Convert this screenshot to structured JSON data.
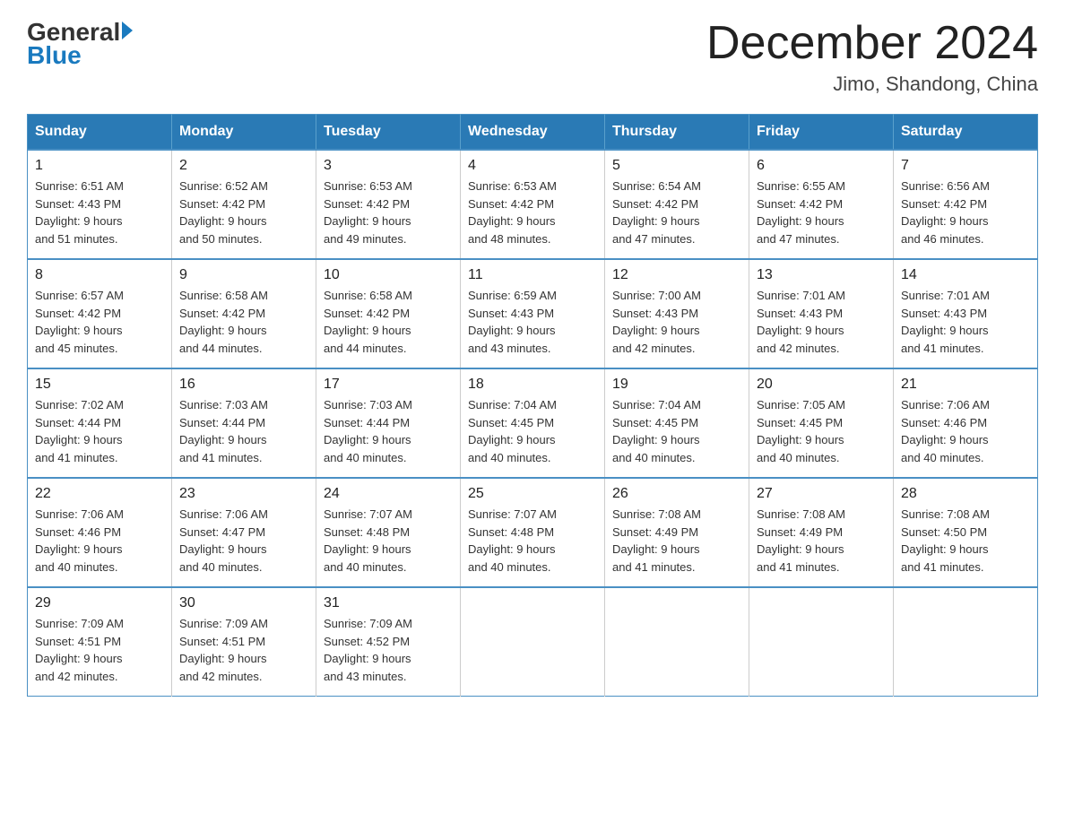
{
  "header": {
    "logo": {
      "general": "General",
      "arrow": "▶",
      "blue": "Blue"
    },
    "title": "December 2024",
    "location": "Jimo, Shandong, China"
  },
  "calendar": {
    "days_of_week": [
      "Sunday",
      "Monday",
      "Tuesday",
      "Wednesday",
      "Thursday",
      "Friday",
      "Saturday"
    ],
    "weeks": [
      [
        {
          "day": "1",
          "sunrise": "6:51 AM",
          "sunset": "4:43 PM",
          "daylight": "9 hours and 51 minutes."
        },
        {
          "day": "2",
          "sunrise": "6:52 AM",
          "sunset": "4:42 PM",
          "daylight": "9 hours and 50 minutes."
        },
        {
          "day": "3",
          "sunrise": "6:53 AM",
          "sunset": "4:42 PM",
          "daylight": "9 hours and 49 minutes."
        },
        {
          "day": "4",
          "sunrise": "6:53 AM",
          "sunset": "4:42 PM",
          "daylight": "9 hours and 48 minutes."
        },
        {
          "day": "5",
          "sunrise": "6:54 AM",
          "sunset": "4:42 PM",
          "daylight": "9 hours and 47 minutes."
        },
        {
          "day": "6",
          "sunrise": "6:55 AM",
          "sunset": "4:42 PM",
          "daylight": "9 hours and 47 minutes."
        },
        {
          "day": "7",
          "sunrise": "6:56 AM",
          "sunset": "4:42 PM",
          "daylight": "9 hours and 46 minutes."
        }
      ],
      [
        {
          "day": "8",
          "sunrise": "6:57 AM",
          "sunset": "4:42 PM",
          "daylight": "9 hours and 45 minutes."
        },
        {
          "day": "9",
          "sunrise": "6:58 AM",
          "sunset": "4:42 PM",
          "daylight": "9 hours and 44 minutes."
        },
        {
          "day": "10",
          "sunrise": "6:58 AM",
          "sunset": "4:42 PM",
          "daylight": "9 hours and 44 minutes."
        },
        {
          "day": "11",
          "sunrise": "6:59 AM",
          "sunset": "4:43 PM",
          "daylight": "9 hours and 43 minutes."
        },
        {
          "day": "12",
          "sunrise": "7:00 AM",
          "sunset": "4:43 PM",
          "daylight": "9 hours and 42 minutes."
        },
        {
          "day": "13",
          "sunrise": "7:01 AM",
          "sunset": "4:43 PM",
          "daylight": "9 hours and 42 minutes."
        },
        {
          "day": "14",
          "sunrise": "7:01 AM",
          "sunset": "4:43 PM",
          "daylight": "9 hours and 41 minutes."
        }
      ],
      [
        {
          "day": "15",
          "sunrise": "7:02 AM",
          "sunset": "4:44 PM",
          "daylight": "9 hours and 41 minutes."
        },
        {
          "day": "16",
          "sunrise": "7:03 AM",
          "sunset": "4:44 PM",
          "daylight": "9 hours and 41 minutes."
        },
        {
          "day": "17",
          "sunrise": "7:03 AM",
          "sunset": "4:44 PM",
          "daylight": "9 hours and 40 minutes."
        },
        {
          "day": "18",
          "sunrise": "7:04 AM",
          "sunset": "4:45 PM",
          "daylight": "9 hours and 40 minutes."
        },
        {
          "day": "19",
          "sunrise": "7:04 AM",
          "sunset": "4:45 PM",
          "daylight": "9 hours and 40 minutes."
        },
        {
          "day": "20",
          "sunrise": "7:05 AM",
          "sunset": "4:45 PM",
          "daylight": "9 hours and 40 minutes."
        },
        {
          "day": "21",
          "sunrise": "7:06 AM",
          "sunset": "4:46 PM",
          "daylight": "9 hours and 40 minutes."
        }
      ],
      [
        {
          "day": "22",
          "sunrise": "7:06 AM",
          "sunset": "4:46 PM",
          "daylight": "9 hours and 40 minutes."
        },
        {
          "day": "23",
          "sunrise": "7:06 AM",
          "sunset": "4:47 PM",
          "daylight": "9 hours and 40 minutes."
        },
        {
          "day": "24",
          "sunrise": "7:07 AM",
          "sunset": "4:48 PM",
          "daylight": "9 hours and 40 minutes."
        },
        {
          "day": "25",
          "sunrise": "7:07 AM",
          "sunset": "4:48 PM",
          "daylight": "9 hours and 40 minutes."
        },
        {
          "day": "26",
          "sunrise": "7:08 AM",
          "sunset": "4:49 PM",
          "daylight": "9 hours and 41 minutes."
        },
        {
          "day": "27",
          "sunrise": "7:08 AM",
          "sunset": "4:49 PM",
          "daylight": "9 hours and 41 minutes."
        },
        {
          "day": "28",
          "sunrise": "7:08 AM",
          "sunset": "4:50 PM",
          "daylight": "9 hours and 41 minutes."
        }
      ],
      [
        {
          "day": "29",
          "sunrise": "7:09 AM",
          "sunset": "4:51 PM",
          "daylight": "9 hours and 42 minutes."
        },
        {
          "day": "30",
          "sunrise": "7:09 AM",
          "sunset": "4:51 PM",
          "daylight": "9 hours and 42 minutes."
        },
        {
          "day": "31",
          "sunrise": "7:09 AM",
          "sunset": "4:52 PM",
          "daylight": "9 hours and 43 minutes."
        },
        null,
        null,
        null,
        null
      ]
    ],
    "labels": {
      "sunrise": "Sunrise:",
      "sunset": "Sunset:",
      "daylight": "Daylight:"
    }
  }
}
